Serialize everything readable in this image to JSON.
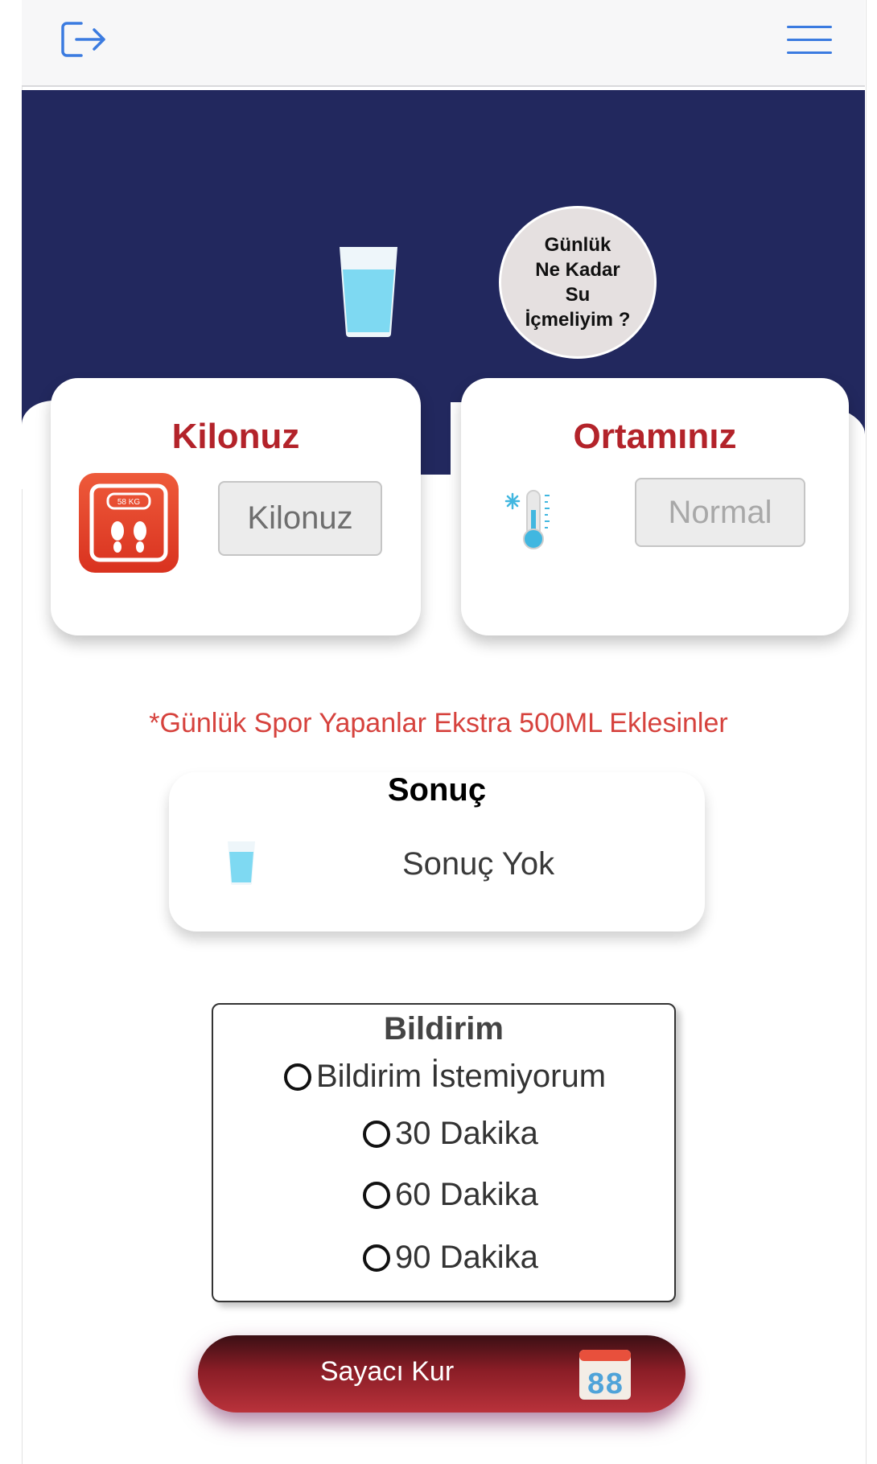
{
  "header": {
    "logout_icon": "logout-icon",
    "menu_icon": "hamburger-menu-icon",
    "accent_color": "#3b7be0"
  },
  "hero": {
    "background_color": "#22285e",
    "bubble_text": "Günlük\nNe Kadar\nSu\nİçmeliyim ?"
  },
  "weight_card": {
    "title": "Kilonuz",
    "input_placeholder": "Kilonuz",
    "icon": "scale-icon",
    "scale_icon_text": "58 KG"
  },
  "environment_card": {
    "title": "Ortamınız",
    "select_value": "Normal",
    "icon": "thermometer-cold-icon"
  },
  "note": "*Günlük Spor Yapanlar Ekstra 500ML Eklesinler",
  "result": {
    "title": "Sonuç",
    "value": "Sonuç Yok",
    "icon": "water-glass-icon"
  },
  "notification": {
    "title": "Bildirim",
    "options": [
      {
        "label": "Bildirim İstemiyorum",
        "selected": false
      },
      {
        "label": "30 Dakika",
        "selected": false
      },
      {
        "label": "60 Dakika",
        "selected": false
      },
      {
        "label": "90 Dakika",
        "selected": false
      }
    ]
  },
  "timer_button": {
    "label": "Sayacı Kur",
    "icon": "calendar-counter-icon",
    "icon_text": "88"
  },
  "colors": {
    "title_red": "#b3232a",
    "note_red": "#d6423d",
    "button_red": "#b9323b"
  }
}
